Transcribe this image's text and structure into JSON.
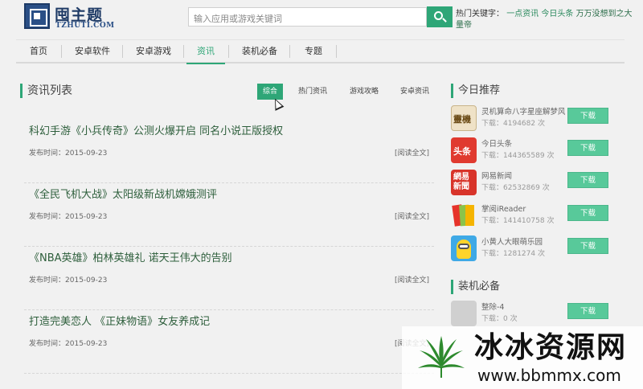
{
  "header": {
    "logo_name": "囤主题",
    "logo_domain": "TZHUTI.COM",
    "search_placeholder": "输入应用或游戏关键词",
    "hot_label": "热门关键字：",
    "hot_keywords": [
      "一点资讯",
      "今日头条",
      "万万没想到之大量帝"
    ]
  },
  "nav": {
    "items": [
      "首页",
      "安卓软件",
      "安卓游戏",
      "资讯",
      "装机必备",
      "专题"
    ],
    "active": "资讯"
  },
  "news": {
    "section_title": "资讯列表",
    "tabs": [
      "综合",
      "热门资讯",
      "游戏攻略",
      "安卓资讯"
    ],
    "active_tab": "综合",
    "date_prefix": "发布时间：",
    "read_more": "[阅读全文]",
    "articles": [
      {
        "title": "科幻手游《小兵传奇》公测火爆开启 同名小说正版授权",
        "date": "2015-09-23"
      },
      {
        "title": "《全民飞机大战》太阳级新战机嫦娥测评",
        "date": "2015-09-23"
      },
      {
        "title": "《NBA英雄》柏林英雄礼 诺天王伟大的告别",
        "date": "2015-09-23"
      },
      {
        "title": "打造完美恋人 《正妹物语》女友养成记",
        "date": "2015-09-23"
      }
    ]
  },
  "sidebar": {
    "today_title": "今日推荐",
    "download_label": "下载",
    "count_prefix": "下载：",
    "count_suffix": "次",
    "today_apps": [
      {
        "name": "灵机算命八字星座解梦风水",
        "count": "4194682",
        "icon": "lingji-app-icon",
        "icon_text": "靈機"
      },
      {
        "name": "今日头条",
        "count": "144365589",
        "icon": "toutiao-app-icon",
        "icon_text": "头条"
      },
      {
        "name": "网易新闻",
        "count": "62532869",
        "icon": "netease-news-app-icon",
        "icon_text": "網易新聞"
      },
      {
        "name": "掌阅iReader",
        "count": "141410758",
        "icon": "ireader-app-icon",
        "icon_text": ""
      },
      {
        "name": "小黄人大眼萌乐园",
        "count": "1281274",
        "icon": "minion-app-icon",
        "icon_text": ""
      }
    ],
    "essentials_title": "装机必备",
    "essential_apps": [
      {
        "name": "整除-4",
        "count": "0",
        "icon": "placeholder-app-icon"
      }
    ]
  },
  "watermark": {
    "chinese": "冰冰资源网",
    "url": "www.bbmmx.com"
  },
  "colors": {
    "accent": "#2ea677",
    "download_button": "#58c99a",
    "article_title": "#2d5e3b",
    "background": "#f1f1f1"
  }
}
